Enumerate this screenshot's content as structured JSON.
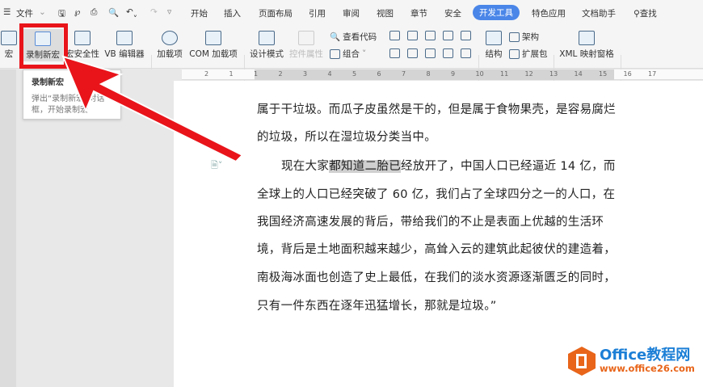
{
  "menubar": {
    "menu_icon": "hamburger-icon",
    "file": "文件",
    "tabs": [
      "开始",
      "插入",
      "页面布局",
      "引用",
      "审阅",
      "视图",
      "章节",
      "安全",
      "开发工具",
      "特色应用",
      "文档助手"
    ],
    "active_tab": "开发工具",
    "search": "查找"
  },
  "ribbon": {
    "macro": "宏",
    "record_macro": "录制新宏",
    "macro_security": "宏安全性",
    "vb_editor": "VB 编辑器",
    "addins": "加载项",
    "com_addins": "COM 加载项",
    "design_mode": "设计模式",
    "control_props": "控件属性",
    "view_code": "查看代码",
    "group": "组合",
    "structure": "结构",
    "schema": "架构",
    "expansion_pack": "扩展包",
    "xml_pane": "XML 映射窗格"
  },
  "ruler": {
    "ticks": [
      "2",
      "1",
      "1",
      "2",
      "3",
      "4",
      "5",
      "6",
      "7",
      "8",
      "9",
      "10",
      "11",
      "12",
      "13",
      "14",
      "15",
      "16",
      "17"
    ]
  },
  "tooltip": {
    "title": "录制新宏",
    "desc_line1": "弹出“录制新宏”对话",
    "desc_line2": "框，开始录制宏"
  },
  "document": {
    "lines": [
      "属于干垃圾。而瓜子皮虽然是干的，但是属于食物果壳，是容易腐烂",
      "的垃圾，所以在湿垃圾分类当中。",
      "全球上的人口已经突破了 60 亿，我们占了全球四分之一的人口，在",
      "我国经济高速发展的背后，带给我们的不止是表面上优越的生活环",
      "境，背后是土地面积越来越少，高耸入云的建筑此起彼伏的建造着，",
      "南极海冰面也创造了史上最低，在我们的淡水资源逐渐匮乏的同时，",
      "只有一件东西在逐年迅猛增长，那就是垃圾。”"
    ],
    "para2_before": "现在大家",
    "para2_highlight": "都知道二胎已",
    "para2_after": "经放开了，中国人口已经逼近 14 亿，而"
  },
  "watermark": {
    "brand": "Office教程网",
    "url": "www.office26.com"
  },
  "colors": {
    "accent": "#4a86e8",
    "highlight_box": "#e8141a"
  }
}
